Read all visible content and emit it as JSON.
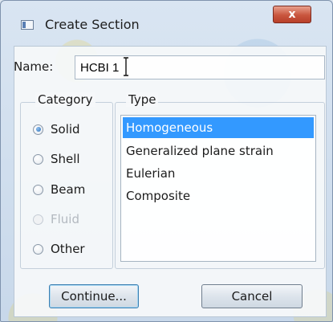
{
  "window": {
    "title": "Create Section",
    "close_glyph": "x"
  },
  "name": {
    "label": "Name:",
    "value": "HCBI 1"
  },
  "category": {
    "legend": "Category",
    "options": [
      {
        "label": "Solid",
        "checked": true,
        "disabled": false
      },
      {
        "label": "Shell",
        "checked": false,
        "disabled": false
      },
      {
        "label": "Beam",
        "checked": false,
        "disabled": false
      },
      {
        "label": "Fluid",
        "checked": false,
        "disabled": true
      },
      {
        "label": "Other",
        "checked": false,
        "disabled": false
      }
    ]
  },
  "type": {
    "legend": "Type",
    "items": [
      "Homogeneous",
      "Generalized plane strain",
      "Eulerian",
      "Composite"
    ],
    "selected": "Homogeneous"
  },
  "buttons": {
    "continue": "Continue...",
    "cancel": "Cancel"
  },
  "colors": {
    "selection": "#3399ff",
    "close_button": "#c9553d"
  }
}
